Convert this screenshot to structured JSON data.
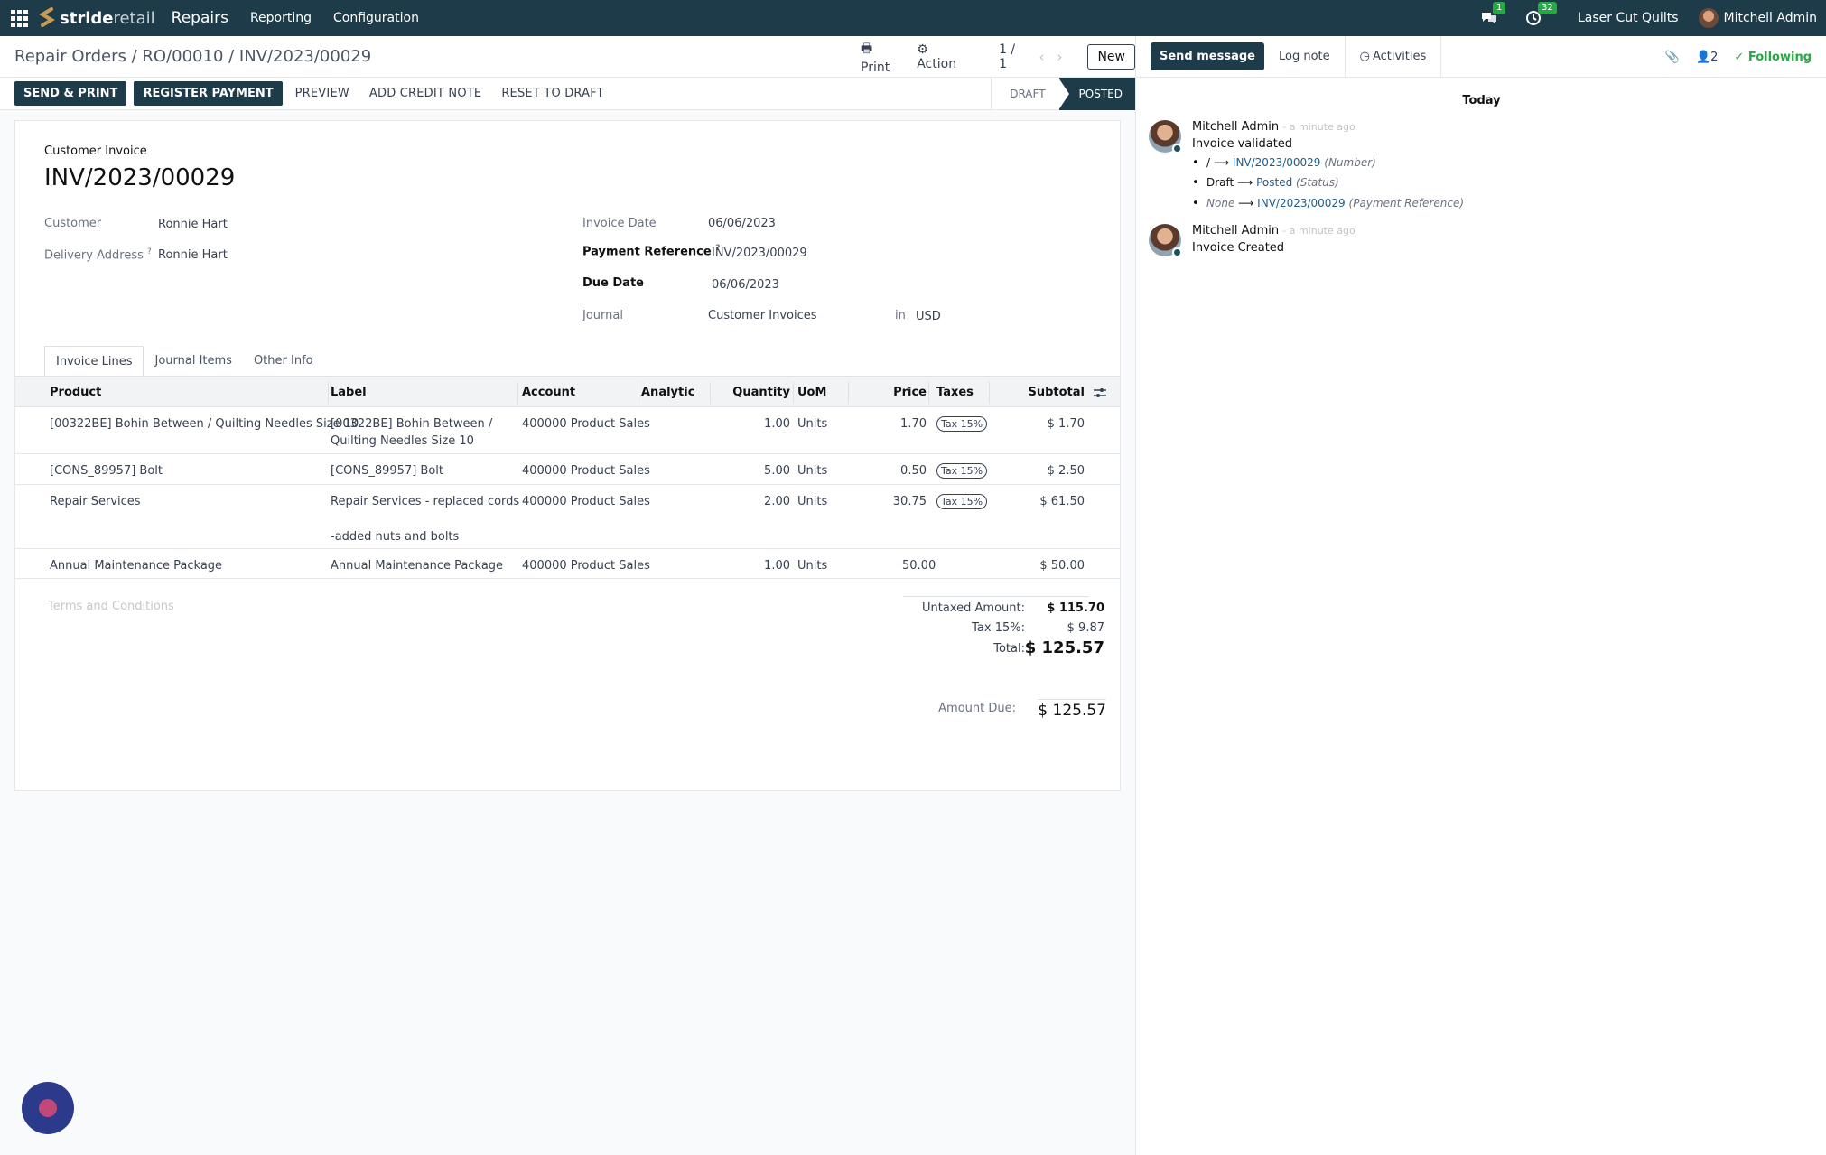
{
  "topbar": {
    "brand_bold": "stride",
    "brand_light": "retail",
    "app": "Repairs",
    "menu": [
      "Reporting",
      "Configuration"
    ],
    "messages_count": "1",
    "activities_count": "32",
    "company": "Laser Cut Quilts",
    "user": "Mitchell Admin"
  },
  "control": {
    "breadcrumb": "Repair Orders / RO/00010 / INV/2023/00029",
    "print": "Print",
    "action": "Action",
    "pager": "1 / 1",
    "new": "New"
  },
  "statusbar": {
    "send_print": "SEND & PRINT",
    "register_payment": "REGISTER PAYMENT",
    "preview": "PREVIEW",
    "add_credit_note": "ADD CREDIT NOTE",
    "reset_to_draft": "RESET TO DRAFT",
    "stage_draft": "DRAFT",
    "stage_posted": "POSTED"
  },
  "invoice": {
    "type": "Customer Invoice",
    "name": "INV/2023/00029",
    "customer_label": "Customer",
    "customer": "Ronnie Hart",
    "delivery_label": "Delivery Address",
    "delivery": "Ronnie Hart",
    "date_label": "Invoice Date",
    "date": "06/06/2023",
    "payref_label": "Payment Reference",
    "payref": "INV/2023/00029",
    "due_label": "Due Date",
    "due": "06/06/2023",
    "journal_label": "Journal",
    "journal": "Customer Invoices",
    "in": "in",
    "currency": "USD",
    "help_mark": "?"
  },
  "tabs": [
    "Invoice Lines",
    "Journal Items",
    "Other Info"
  ],
  "table": {
    "headers": {
      "product": "Product",
      "label": "Label",
      "account": "Account",
      "analytic": "Analytic",
      "quantity": "Quantity",
      "uom": "UoM",
      "price": "Price",
      "taxes": "Taxes",
      "subtotal": "Subtotal"
    },
    "rows": [
      {
        "product": "[00322BE] Bohin Between / Quilting Needles Size 10",
        "label": "[00322BE] Bohin Between / Quilting Needles Size 10",
        "account": "400000 Product Sales",
        "quantity": "1.00",
        "uom": "Units",
        "price": "1.70",
        "tax": "Tax 15%",
        "subtotal": "$ 1.70"
      },
      {
        "product": "[CONS_89957] Bolt",
        "label": "[CONS_89957] Bolt",
        "account": "400000 Product Sales",
        "quantity": "5.00",
        "uom": "Units",
        "price": "0.50",
        "tax": "Tax 15%",
        "subtotal": "$ 2.50"
      },
      {
        "product": "Repair Services",
        "label": "Repair Services - replaced cords",
        "label2": "-added nuts and bolts",
        "account": "400000 Product Sales",
        "quantity": "2.00",
        "uom": "Units",
        "price": "30.75",
        "tax": "Tax 15%",
        "subtotal": "$ 61.50"
      },
      {
        "product": "Annual Maintenance Package",
        "label": "Annual Maintenance Package",
        "account": "400000 Product Sales",
        "quantity": "1.00",
        "uom": "Units",
        "price": "50.00",
        "tax": "",
        "subtotal": "$ 50.00"
      }
    ]
  },
  "terms_placeholder": "Terms and Conditions",
  "totals": {
    "untaxed_label": "Untaxed Amount:",
    "untaxed": "$ 115.70",
    "tax_label": "Tax 15%:",
    "tax": "$ 9.87",
    "total_label": "Total:",
    "total": "$ 125.57",
    "due_label": "Amount Due:",
    "due": "$ 125.57"
  },
  "chatter": {
    "send_message": "Send message",
    "log_note": "Log note",
    "activities": "Activities",
    "followers": "2",
    "following": "Following",
    "today": "Today",
    "messages": [
      {
        "author": "Mitchell Admin",
        "time": "- a minute ago",
        "body": "Invoice validated",
        "changes": [
          {
            "old": "/",
            "new": "INV/2023/00029",
            "field": "(Number)"
          },
          {
            "old": "Draft",
            "new": "Posted",
            "field": "(Status)"
          },
          {
            "old": "None",
            "new": "INV/2023/00029",
            "field": "(Payment Reference)"
          }
        ]
      },
      {
        "author": "Mitchell Admin",
        "time": "- a minute ago",
        "body": "Invoice Created"
      }
    ]
  }
}
